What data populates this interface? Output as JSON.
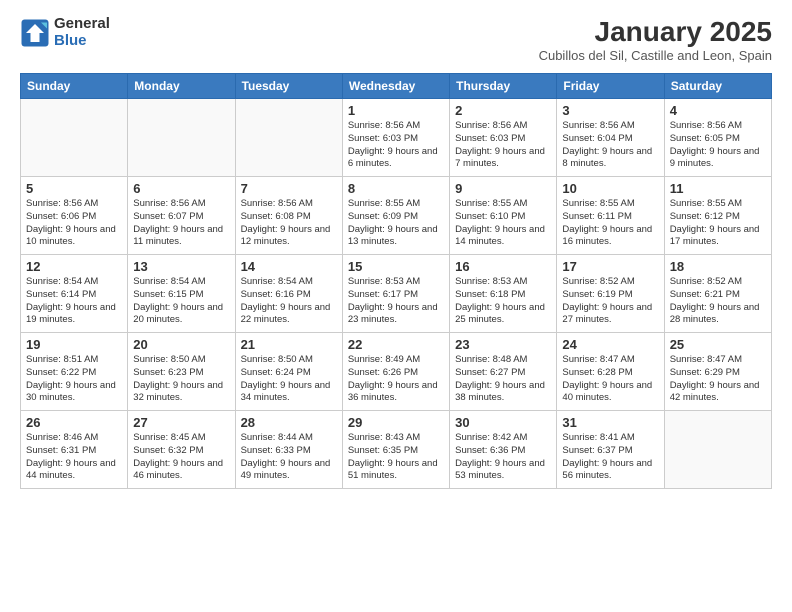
{
  "logo": {
    "general": "General",
    "blue": "Blue"
  },
  "header": {
    "month": "January 2025",
    "location": "Cubillos del Sil, Castille and Leon, Spain"
  },
  "weekdays": [
    "Sunday",
    "Monday",
    "Tuesday",
    "Wednesday",
    "Thursday",
    "Friday",
    "Saturday"
  ],
  "weeks": [
    [
      {
        "day": "",
        "info": ""
      },
      {
        "day": "",
        "info": ""
      },
      {
        "day": "",
        "info": ""
      },
      {
        "day": "1",
        "info": "Sunrise: 8:56 AM\nSunset: 6:03 PM\nDaylight: 9 hours and 6 minutes."
      },
      {
        "day": "2",
        "info": "Sunrise: 8:56 AM\nSunset: 6:03 PM\nDaylight: 9 hours and 7 minutes."
      },
      {
        "day": "3",
        "info": "Sunrise: 8:56 AM\nSunset: 6:04 PM\nDaylight: 9 hours and 8 minutes."
      },
      {
        "day": "4",
        "info": "Sunrise: 8:56 AM\nSunset: 6:05 PM\nDaylight: 9 hours and 9 minutes."
      }
    ],
    [
      {
        "day": "5",
        "info": "Sunrise: 8:56 AM\nSunset: 6:06 PM\nDaylight: 9 hours and 10 minutes."
      },
      {
        "day": "6",
        "info": "Sunrise: 8:56 AM\nSunset: 6:07 PM\nDaylight: 9 hours and 11 minutes."
      },
      {
        "day": "7",
        "info": "Sunrise: 8:56 AM\nSunset: 6:08 PM\nDaylight: 9 hours and 12 minutes."
      },
      {
        "day": "8",
        "info": "Sunrise: 8:55 AM\nSunset: 6:09 PM\nDaylight: 9 hours and 13 minutes."
      },
      {
        "day": "9",
        "info": "Sunrise: 8:55 AM\nSunset: 6:10 PM\nDaylight: 9 hours and 14 minutes."
      },
      {
        "day": "10",
        "info": "Sunrise: 8:55 AM\nSunset: 6:11 PM\nDaylight: 9 hours and 16 minutes."
      },
      {
        "day": "11",
        "info": "Sunrise: 8:55 AM\nSunset: 6:12 PM\nDaylight: 9 hours and 17 minutes."
      }
    ],
    [
      {
        "day": "12",
        "info": "Sunrise: 8:54 AM\nSunset: 6:14 PM\nDaylight: 9 hours and 19 minutes."
      },
      {
        "day": "13",
        "info": "Sunrise: 8:54 AM\nSunset: 6:15 PM\nDaylight: 9 hours and 20 minutes."
      },
      {
        "day": "14",
        "info": "Sunrise: 8:54 AM\nSunset: 6:16 PM\nDaylight: 9 hours and 22 minutes."
      },
      {
        "day": "15",
        "info": "Sunrise: 8:53 AM\nSunset: 6:17 PM\nDaylight: 9 hours and 23 minutes."
      },
      {
        "day": "16",
        "info": "Sunrise: 8:53 AM\nSunset: 6:18 PM\nDaylight: 9 hours and 25 minutes."
      },
      {
        "day": "17",
        "info": "Sunrise: 8:52 AM\nSunset: 6:19 PM\nDaylight: 9 hours and 27 minutes."
      },
      {
        "day": "18",
        "info": "Sunrise: 8:52 AM\nSunset: 6:21 PM\nDaylight: 9 hours and 28 minutes."
      }
    ],
    [
      {
        "day": "19",
        "info": "Sunrise: 8:51 AM\nSunset: 6:22 PM\nDaylight: 9 hours and 30 minutes."
      },
      {
        "day": "20",
        "info": "Sunrise: 8:50 AM\nSunset: 6:23 PM\nDaylight: 9 hours and 32 minutes."
      },
      {
        "day": "21",
        "info": "Sunrise: 8:50 AM\nSunset: 6:24 PM\nDaylight: 9 hours and 34 minutes."
      },
      {
        "day": "22",
        "info": "Sunrise: 8:49 AM\nSunset: 6:26 PM\nDaylight: 9 hours and 36 minutes."
      },
      {
        "day": "23",
        "info": "Sunrise: 8:48 AM\nSunset: 6:27 PM\nDaylight: 9 hours and 38 minutes."
      },
      {
        "day": "24",
        "info": "Sunrise: 8:47 AM\nSunset: 6:28 PM\nDaylight: 9 hours and 40 minutes."
      },
      {
        "day": "25",
        "info": "Sunrise: 8:47 AM\nSunset: 6:29 PM\nDaylight: 9 hours and 42 minutes."
      }
    ],
    [
      {
        "day": "26",
        "info": "Sunrise: 8:46 AM\nSunset: 6:31 PM\nDaylight: 9 hours and 44 minutes."
      },
      {
        "day": "27",
        "info": "Sunrise: 8:45 AM\nSunset: 6:32 PM\nDaylight: 9 hours and 46 minutes."
      },
      {
        "day": "28",
        "info": "Sunrise: 8:44 AM\nSunset: 6:33 PM\nDaylight: 9 hours and 49 minutes."
      },
      {
        "day": "29",
        "info": "Sunrise: 8:43 AM\nSunset: 6:35 PM\nDaylight: 9 hours and 51 minutes."
      },
      {
        "day": "30",
        "info": "Sunrise: 8:42 AM\nSunset: 6:36 PM\nDaylight: 9 hours and 53 minutes."
      },
      {
        "day": "31",
        "info": "Sunrise: 8:41 AM\nSunset: 6:37 PM\nDaylight: 9 hours and 56 minutes."
      },
      {
        "day": "",
        "info": ""
      }
    ]
  ]
}
